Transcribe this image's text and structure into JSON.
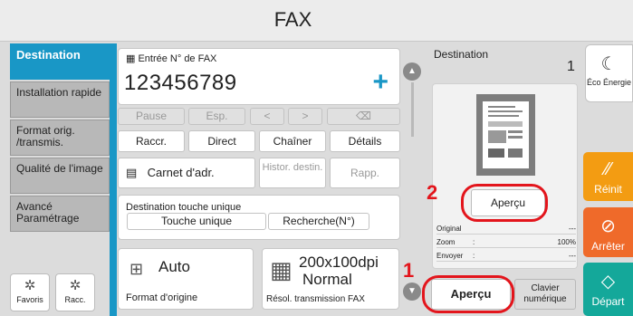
{
  "header": {
    "title": "FAX"
  },
  "tabs": [
    {
      "label": "Destination",
      "active": true
    },
    {
      "label": "Installation rapide"
    },
    {
      "label": "Format orig. /transmis."
    },
    {
      "label": "Qualité de l'image"
    },
    {
      "label": "Avancé Paramétrage"
    }
  ],
  "bottom_icons": {
    "favorites_label": "Favoris",
    "shortcut_label": "Racc."
  },
  "fax_entry": {
    "label": "Entrée N° de FAX",
    "number": "123456789",
    "add_symbol": "+"
  },
  "keypad": {
    "pause": "Pause",
    "space": "Esp.",
    "left": "<",
    "right": ">",
    "backspace": "⌫"
  },
  "dial_modes": {
    "raccr": "Raccr.",
    "direct": "Direct",
    "chainer": "Chaîner",
    "details": "Détails"
  },
  "book_row": {
    "address_book": "Carnet d'adr.",
    "history": "Histor. destin.",
    "recall": "Rapp."
  },
  "one_touch": {
    "label": "Destination touche unique",
    "one_touch_button": "Touche unique",
    "search_button": "Recherche(N°)"
  },
  "original_format": {
    "value": "Auto",
    "caption": "Format d'origine"
  },
  "resolution": {
    "value_line1": "200x100dpi",
    "value_line2": "Normal",
    "caption": "Résol. transmission FAX"
  },
  "destination_panel": {
    "title": "Destination",
    "count": "1",
    "preview_button": "Aperçu",
    "rows": [
      {
        "label": "Original",
        "value": "---"
      },
      {
        "label": "Zoom",
        "sep": ":",
        "value": "100%"
      },
      {
        "label": "Envoyer",
        "sep": ":",
        "value": "---"
      }
    ]
  },
  "bottom_buttons": {
    "preview": "Aperçu",
    "keypad": "Clavier numérique"
  },
  "callouts": {
    "one": "1",
    "two": "2"
  },
  "right_column": {
    "eco": "Éco Énergie",
    "reset": "Réinit",
    "stop": "Arrêter",
    "start": "Départ"
  },
  "colors": {
    "accent": "#1997c6",
    "callout": "#e3151c",
    "reset": "#f39c12",
    "stop": "#ef6a2a",
    "start": "#14a89a"
  }
}
